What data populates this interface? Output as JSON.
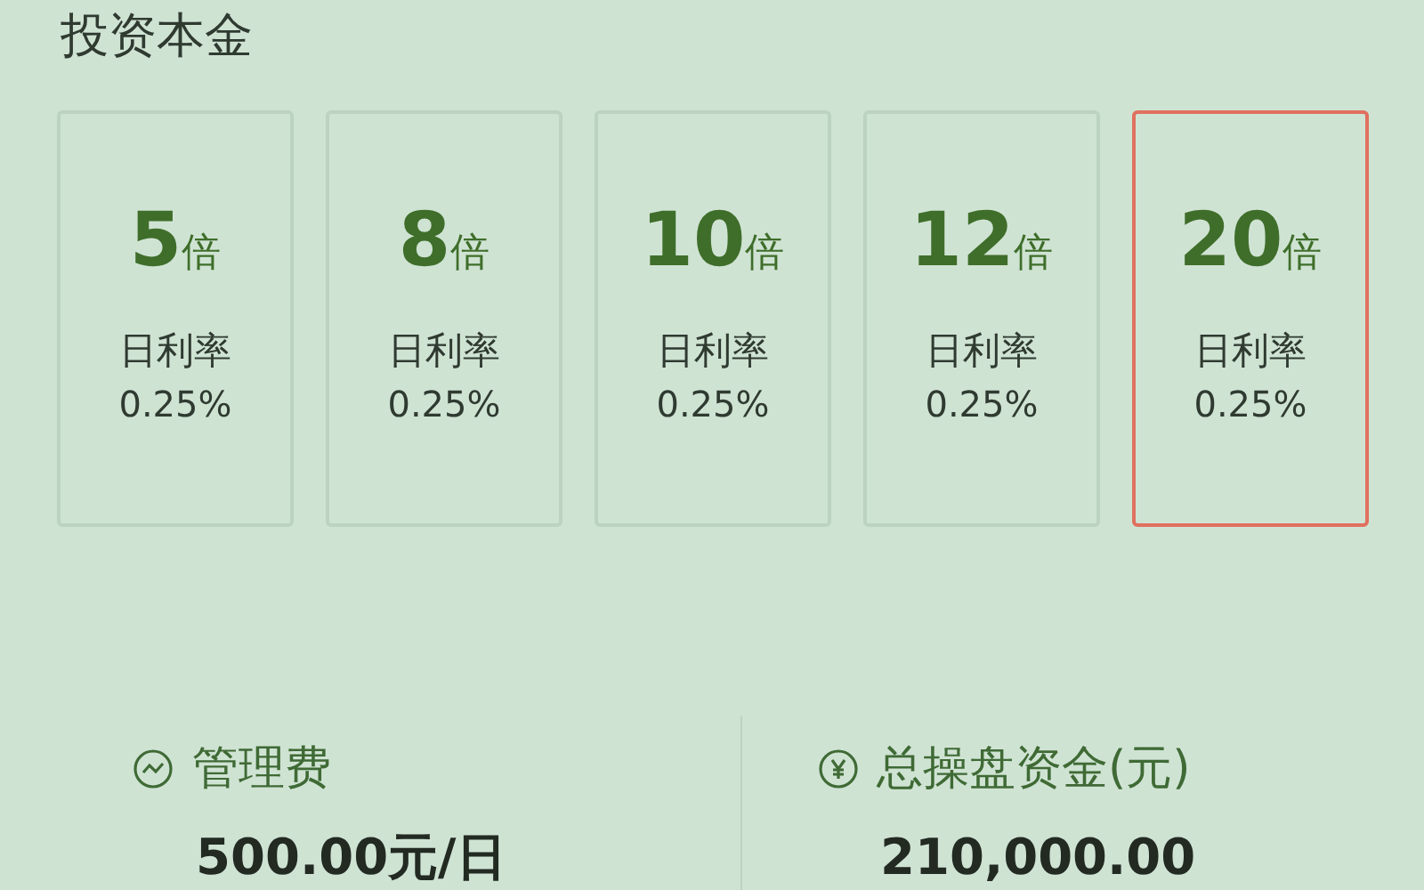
{
  "title": "投资本金",
  "options": [
    {
      "value": "5",
      "unit": "倍",
      "rate_label": "日利率",
      "rate": "0.25%",
      "selected": false
    },
    {
      "value": "8",
      "unit": "倍",
      "rate_label": "日利率",
      "rate": "0.25%",
      "selected": false
    },
    {
      "value": "10",
      "unit": "倍",
      "rate_label": "日利率",
      "rate": "0.25%",
      "selected": false
    },
    {
      "value": "12",
      "unit": "倍",
      "rate_label": "日利率",
      "rate": "0.25%",
      "selected": false
    },
    {
      "value": "20",
      "unit": "倍",
      "rate_label": "日利率",
      "rate": "0.25%",
      "selected": true
    }
  ],
  "stats": [
    {
      "kind": "trend",
      "label": "管理费",
      "value": "500.00元/日"
    },
    {
      "kind": "yen",
      "label": "总操盘资金(元)",
      "value": "210,000.00"
    }
  ]
}
